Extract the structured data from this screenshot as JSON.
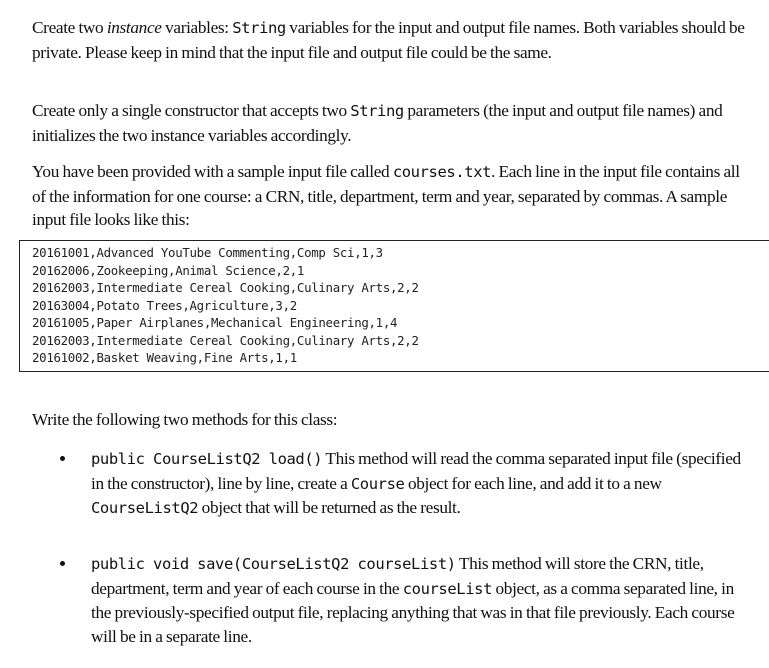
{
  "paragraphs": {
    "instance_vars": {
      "t1": "Create two ",
      "t2": "instance",
      "t3": " variables: ",
      "code1": "String",
      "t4": " variables for the input and output file names. Both variables should be private. Please keep in mind that the input file and output file could be the same."
    },
    "constructor": {
      "t1": "Create only a single constructor that accepts two ",
      "code1": "String",
      "t2": " parameters (the input and output file names) and initializes the two instance variables accordingly."
    },
    "sample": {
      "t1": "You have been provided with a sample input file called ",
      "code1": "courses.txt",
      "t2": ". Each line in the input file contains all of the information for one course: a CRN, title, department, term and year, separated by commas. A sample input file looks like this:"
    },
    "methods_intro": "Write the following two methods for this class:"
  },
  "sample_file_lines": [
    "20161001,Advanced YouTube Commenting,Comp Sci,1,3",
    "20162006,Zookeeping,Animal Science,2,1",
    "20162003,Intermediate Cereal Cooking,Culinary Arts,2,2",
    "20163004,Potato Trees,Agriculture,3,2",
    "20161005,Paper Airplanes,Mechanical Engineering,1,4",
    "20162003,Intermediate Cereal Cooking,Culinary Arts,2,2",
    "20161002,Basket Weaving,Fine Arts,1,1"
  ],
  "methods": [
    {
      "signature": "public CourseListQ2 load()",
      "t1": " This method will read the comma separated input file (specified in the constructor), line by line, create a ",
      "code1": "Course",
      "t2": " object for each line, and add it to a new ",
      "code2": "CourseListQ2",
      "t3": " object that will be returned as the result."
    },
    {
      "signature": "public void save(CourseListQ2 courseList)",
      "t1": " This method will store the CRN, title, department, term and year of each course in the ",
      "code1": "courseList",
      "t2": " object, as a comma separated line, in the previously-specified output file, replacing anything that was in that file previously. Each course will be in a separate line."
    }
  ]
}
